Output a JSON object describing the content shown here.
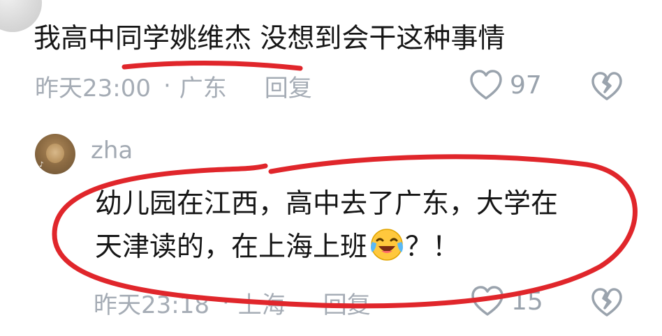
{
  "top_comment": {
    "text": "我高中同学姚维杰 没想到会干这种事情",
    "time": "昨天23:00",
    "location": "广东",
    "reply_label": "回复",
    "like_count": "97"
  },
  "reply_comment": {
    "username": "zha",
    "text_line1": "幼儿园在江西，高中去了广东，大学在",
    "text_line2": "天津读的，在上海上班",
    "text_suffix": "？！",
    "time": "昨天23:18",
    "location": "上海",
    "reply_label": "回复",
    "like_count": "15"
  },
  "separator": "·",
  "icons": {
    "like": "heart-outline-icon",
    "dislike": "broken-heart-icon",
    "emoji": "laughing-crying-emoji"
  },
  "colors": {
    "text_primary": "#161616",
    "text_secondary": "#a5acb5",
    "annotation_red": "#e0262b"
  }
}
